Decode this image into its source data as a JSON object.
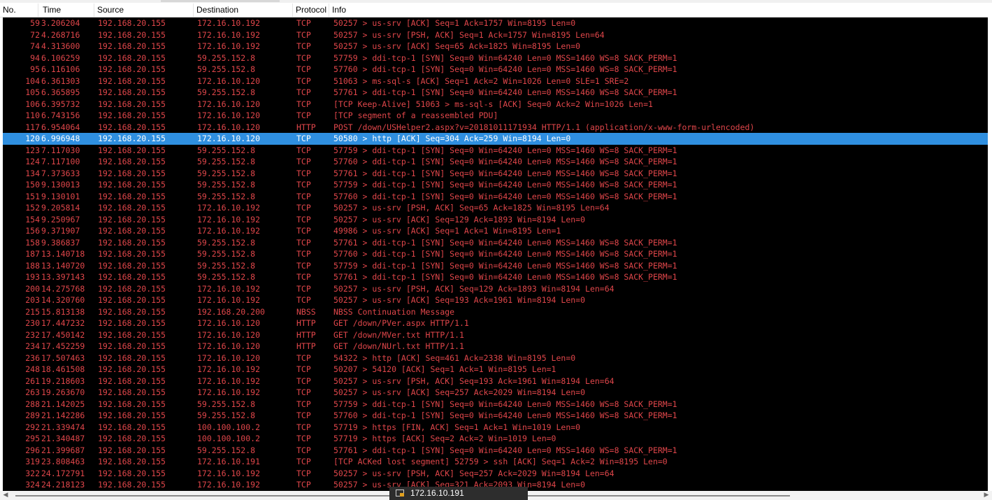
{
  "columns": [
    "No.",
    "Time",
    "Source",
    "Destination",
    "Protocol",
    "Info"
  ],
  "selected_index": 10,
  "colors": {
    "row_bg": "#000000",
    "row_fg": "#e0464a",
    "selected_bg": "#2f8fe0",
    "selected_fg": "#ffffff"
  },
  "tooltip": {
    "icon": "network-icon",
    "text": "172.16.10.191"
  },
  "packets": [
    {
      "no": "59",
      "time": "3.206204",
      "src": "192.168.20.155",
      "dst": "172.16.10.192",
      "proto": "TCP",
      "info": "50257 > us-srv [ACK] Seq=1 Ack=1757 Win=8195 Len=0"
    },
    {
      "no": "72",
      "time": "4.268716",
      "src": "192.168.20.155",
      "dst": "172.16.10.192",
      "proto": "TCP",
      "info": "50257 > us-srv [PSH, ACK] Seq=1 Ack=1757 Win=8195 Len=64"
    },
    {
      "no": "74",
      "time": "4.313600",
      "src": "192.168.20.155",
      "dst": "172.16.10.192",
      "proto": "TCP",
      "info": "50257 > us-srv [ACK] Seq=65 Ack=1825 Win=8195 Len=0"
    },
    {
      "no": "94",
      "time": "6.106259",
      "src": "192.168.20.155",
      "dst": "59.255.152.8",
      "proto": "TCP",
      "info": "57759 > ddi-tcp-1 [SYN] Seq=0 Win=64240 Len=0 MSS=1460 WS=8 SACK_PERM=1"
    },
    {
      "no": "95",
      "time": "6.116106",
      "src": "192.168.20.155",
      "dst": "59.255.152.8",
      "proto": "TCP",
      "info": "57760 > ddi-tcp-1 [SYN] Seq=0 Win=64240 Len=0 MSS=1460 WS=8 SACK_PERM=1"
    },
    {
      "no": "104",
      "time": "6.361303",
      "src": "192.168.20.155",
      "dst": "172.16.10.120",
      "proto": "TCP",
      "info": "51063 > ms-sql-s [ACK] Seq=1 Ack=2 Win=1026 Len=0 SLE=1 SRE=2"
    },
    {
      "no": "105",
      "time": "6.365895",
      "src": "192.168.20.155",
      "dst": "59.255.152.8",
      "proto": "TCP",
      "info": "57761 > ddi-tcp-1 [SYN] Seq=0 Win=64240 Len=0 MSS=1460 WS=8 SACK_PERM=1"
    },
    {
      "no": "106",
      "time": "6.395732",
      "src": "192.168.20.155",
      "dst": "172.16.10.120",
      "proto": "TCP",
      "info": "[TCP Keep-Alive] 51063 > ms-sql-s [ACK] Seq=0 Ack=2 Win=1026 Len=1"
    },
    {
      "no": "110",
      "time": "6.743156",
      "src": "192.168.20.155",
      "dst": "172.16.10.120",
      "proto": "TCP",
      "info": "[TCP segment of a reassembled PDU]"
    },
    {
      "no": "117",
      "time": "6.954064",
      "src": "192.168.20.155",
      "dst": "172.16.10.120",
      "proto": "HTTP",
      "info": "POST /down/USHelper2.aspx?v=20181011171934 HTTP/1.1  (application/x-www-form-urlencoded)"
    },
    {
      "no": "120",
      "time": "6.996948",
      "src": "192.168.20.155",
      "dst": "172.16.10.120",
      "proto": "TCP",
      "info": "50580 > http [ACK] Seq=304 Ack=259 Win=8194 Len=0"
    },
    {
      "no": "123",
      "time": "7.117030",
      "src": "192.168.20.155",
      "dst": "59.255.152.8",
      "proto": "TCP",
      "info": "57759 > ddi-tcp-1 [SYN] Seq=0 Win=64240 Len=0 MSS=1460 WS=8 SACK_PERM=1"
    },
    {
      "no": "124",
      "time": "7.117100",
      "src": "192.168.20.155",
      "dst": "59.255.152.8",
      "proto": "TCP",
      "info": "57760 > ddi-tcp-1 [SYN] Seq=0 Win=64240 Len=0 MSS=1460 WS=8 SACK_PERM=1"
    },
    {
      "no": "134",
      "time": "7.373633",
      "src": "192.168.20.155",
      "dst": "59.255.152.8",
      "proto": "TCP",
      "info": "57761 > ddi-tcp-1 [SYN] Seq=0 Win=64240 Len=0 MSS=1460 WS=8 SACK_PERM=1"
    },
    {
      "no": "150",
      "time": "9.130013",
      "src": "192.168.20.155",
      "dst": "59.255.152.8",
      "proto": "TCP",
      "info": "57759 > ddi-tcp-1 [SYN] Seq=0 Win=64240 Len=0 MSS=1460 WS=8 SACK_PERM=1"
    },
    {
      "no": "151",
      "time": "9.130101",
      "src": "192.168.20.155",
      "dst": "59.255.152.8",
      "proto": "TCP",
      "info": "57760 > ddi-tcp-1 [SYN] Seq=0 Win=64240 Len=0 MSS=1460 WS=8 SACK_PERM=1"
    },
    {
      "no": "152",
      "time": "9.205814",
      "src": "192.168.20.155",
      "dst": "172.16.10.192",
      "proto": "TCP",
      "info": "50257 > us-srv [PSH, ACK] Seq=65 Ack=1825 Win=8195 Len=64"
    },
    {
      "no": "154",
      "time": "9.250967",
      "src": "192.168.20.155",
      "dst": "172.16.10.192",
      "proto": "TCP",
      "info": "50257 > us-srv [ACK] Seq=129 Ack=1893 Win=8194 Len=0"
    },
    {
      "no": "156",
      "time": "9.371907",
      "src": "192.168.20.155",
      "dst": "172.16.10.192",
      "proto": "TCP",
      "info": "49986 > us-srv [ACK] Seq=1 Ack=1 Win=8195 Len=1"
    },
    {
      "no": "158",
      "time": "9.386837",
      "src": "192.168.20.155",
      "dst": "59.255.152.8",
      "proto": "TCP",
      "info": "57761 > ddi-tcp-1 [SYN] Seq=0 Win=64240 Len=0 MSS=1460 WS=8 SACK_PERM=1"
    },
    {
      "no": "187",
      "time": "13.140718",
      "src": "192.168.20.155",
      "dst": "59.255.152.8",
      "proto": "TCP",
      "info": "57760 > ddi-tcp-1 [SYN] Seq=0 Win=64240 Len=0 MSS=1460 WS=8 SACK_PERM=1"
    },
    {
      "no": "188",
      "time": "13.140720",
      "src": "192.168.20.155",
      "dst": "59.255.152.8",
      "proto": "TCP",
      "info": "57759 > ddi-tcp-1 [SYN] Seq=0 Win=64240 Len=0 MSS=1460 WS=8 SACK_PERM=1"
    },
    {
      "no": "193",
      "time": "13.397143",
      "src": "192.168.20.155",
      "dst": "59.255.152.8",
      "proto": "TCP",
      "info": "57761 > ddi-tcp-1 [SYN] Seq=0 Win=64240 Len=0 MSS=1460 WS=8 SACK_PERM=1"
    },
    {
      "no": "200",
      "time": "14.275768",
      "src": "192.168.20.155",
      "dst": "172.16.10.192",
      "proto": "TCP",
      "info": "50257 > us-srv [PSH, ACK] Seq=129 Ack=1893 Win=8194 Len=64"
    },
    {
      "no": "203",
      "time": "14.320760",
      "src": "192.168.20.155",
      "dst": "172.16.10.192",
      "proto": "TCP",
      "info": "50257 > us-srv [ACK] Seq=193 Ack=1961 Win=8194 Len=0"
    },
    {
      "no": "215",
      "time": "15.813138",
      "src": "192.168.20.155",
      "dst": "192.168.20.200",
      "proto": "NBSS",
      "info": "NBSS Continuation Message"
    },
    {
      "no": "230",
      "time": "17.447232",
      "src": "192.168.20.155",
      "dst": "172.16.10.120",
      "proto": "HTTP",
      "info": "GET /down/PVer.aspx HTTP/1.1"
    },
    {
      "no": "232",
      "time": "17.450142",
      "src": "192.168.20.155",
      "dst": "172.16.10.120",
      "proto": "HTTP",
      "info": "GET /down/MVer.txt HTTP/1.1"
    },
    {
      "no": "234",
      "time": "17.452259",
      "src": "192.168.20.155",
      "dst": "172.16.10.120",
      "proto": "HTTP",
      "info": "GET /down/NUrl.txt HTTP/1.1"
    },
    {
      "no": "236",
      "time": "17.507463",
      "src": "192.168.20.155",
      "dst": "172.16.10.120",
      "proto": "TCP",
      "info": "54322 > http [ACK] Seq=461 Ack=2338 Win=8195 Len=0"
    },
    {
      "no": "248",
      "time": "18.461508",
      "src": "192.168.20.155",
      "dst": "172.16.10.192",
      "proto": "TCP",
      "info": "50207 > 54120 [ACK] Seq=1 Ack=1 Win=8195 Len=1"
    },
    {
      "no": "261",
      "time": "19.218603",
      "src": "192.168.20.155",
      "dst": "172.16.10.192",
      "proto": "TCP",
      "info": "50257 > us-srv [PSH, ACK] Seq=193 Ack=1961 Win=8194 Len=64"
    },
    {
      "no": "263",
      "time": "19.263670",
      "src": "192.168.20.155",
      "dst": "172.16.10.192",
      "proto": "TCP",
      "info": "50257 > us-srv [ACK] Seq=257 Ack=2029 Win=8194 Len=0"
    },
    {
      "no": "288",
      "time": "21.142025",
      "src": "192.168.20.155",
      "dst": "59.255.152.8",
      "proto": "TCP",
      "info": "57759 > ddi-tcp-1 [SYN] Seq=0 Win=64240 Len=0 MSS=1460 WS=8 SACK_PERM=1"
    },
    {
      "no": "289",
      "time": "21.142286",
      "src": "192.168.20.155",
      "dst": "59.255.152.8",
      "proto": "TCP",
      "info": "57760 > ddi-tcp-1 [SYN] Seq=0 Win=64240 Len=0 MSS=1460 WS=8 SACK_PERM=1"
    },
    {
      "no": "292",
      "time": "21.339474",
      "src": "192.168.20.155",
      "dst": "100.100.100.2",
      "proto": "TCP",
      "info": "57719 > https [FIN, ACK] Seq=1 Ack=1 Win=1019 Len=0"
    },
    {
      "no": "295",
      "time": "21.340487",
      "src": "192.168.20.155",
      "dst": "100.100.100.2",
      "proto": "TCP",
      "info": "57719 > https [ACK] Seq=2 Ack=2 Win=1019 Len=0"
    },
    {
      "no": "296",
      "time": "21.399687",
      "src": "192.168.20.155",
      "dst": "59.255.152.8",
      "proto": "TCP",
      "info": "57761 > ddi-tcp-1 [SYN] Seq=0 Win=64240 Len=0 MSS=1460 WS=8 SACK_PERM=1"
    },
    {
      "no": "319",
      "time": "23.808463",
      "src": "192.168.20.155",
      "dst": "172.16.10.191",
      "proto": "TCP",
      "info": "[TCP ACKed lost segment] 52759 > ssh [ACK] Seq=1 Ack=2 Win=8195 Len=0"
    },
    {
      "no": "322",
      "time": "24.172791",
      "src": "192.168.20.155",
      "dst": "172.16.10.192",
      "proto": "TCP",
      "info": "50257 > us-srv [PSH, ACK] Seq=257 Ack=2029 Win=8194 Len=64"
    },
    {
      "no": "324",
      "time": "24.218123",
      "src": "192.168.20.155",
      "dst": "172.16.10.192",
      "proto": "TCP",
      "info": "50257 > us-srv [ACK] Seq=321 Ack=2093 Win=8194 Len=0"
    }
  ]
}
